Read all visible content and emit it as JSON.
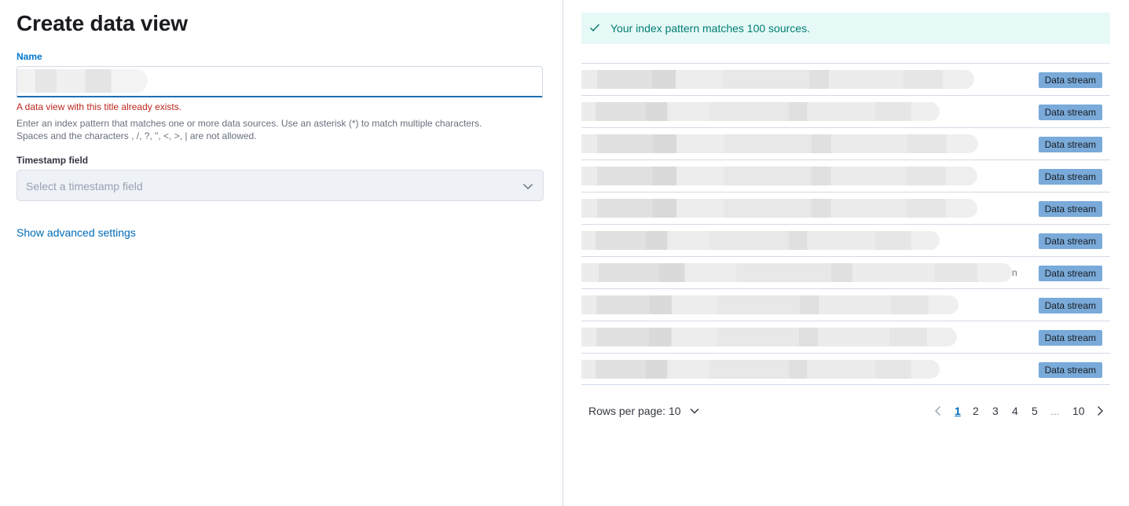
{
  "form": {
    "title": "Create data view",
    "name_label": "Name",
    "name_value": "",
    "error_text": "A data view with this title already exists.",
    "help_line1": "Enter an index pattern that matches one or more data sources. Use an asterisk (*) to match multiple characters.",
    "help_line2": "Spaces and the characters , /, ?, \", <, >, | are not allowed.",
    "timestamp_label": "Timestamp field",
    "timestamp_placeholder": "Select a timestamp field",
    "advanced_link": "Show advanced settings"
  },
  "callout": {
    "text": "Your index pattern matches 100 sources.",
    "icon": "check-icon",
    "color": "#017d73",
    "background": "#e6f9f7"
  },
  "sources": {
    "rows": [
      {
        "type": "Data stream",
        "suffix": ""
      },
      {
        "type": "Data stream",
        "suffix": ""
      },
      {
        "type": "Data stream",
        "suffix": ""
      },
      {
        "type": "Data stream",
        "suffix": ""
      },
      {
        "type": "Data stream",
        "suffix": ""
      },
      {
        "type": "Data stream",
        "suffix": ""
      },
      {
        "type": "Data stream",
        "suffix": "n"
      },
      {
        "type": "Data stream",
        "suffix": ""
      },
      {
        "type": "Data stream",
        "suffix": ""
      },
      {
        "type": "Data stream",
        "suffix": ""
      }
    ],
    "badge_color": "#79aad9"
  },
  "footer": {
    "rows_per_page": "Rows per page: 10",
    "pages": [
      "1",
      "2",
      "3",
      "4",
      "5",
      "...",
      "10"
    ],
    "active_page": "1"
  }
}
